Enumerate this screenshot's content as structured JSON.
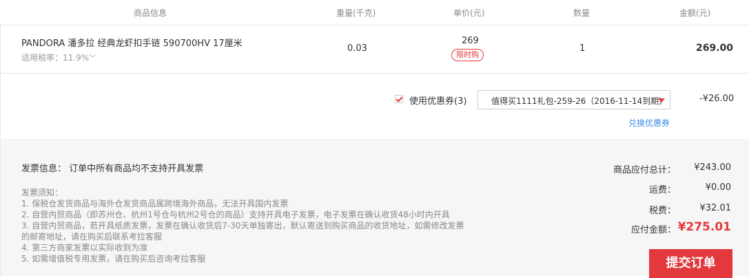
{
  "table_header": {
    "product_info": "商品信息",
    "weight": "重量(千克)",
    "unit_price": "单价(元)",
    "quantity": "数量",
    "amount": "金额(元)"
  },
  "item": {
    "name": "PANDORA 潘多拉 经典龙虾扣手链 590700HV  17厘米",
    "tax_rate": "适用税率：11.9%",
    "weight": "0.03",
    "price": "269",
    "tag": "限时购",
    "quantity": "1",
    "amount": "269.00"
  },
  "coupon": {
    "use_label": "使用优惠券(3)",
    "selected": "值得买1111礼包-259-26（2016-11-14到期)",
    "discount": "-¥26.00",
    "exchange_link": "兑换优惠券"
  },
  "invoice": {
    "title": "发票信息：  订单中所有商品均不支持开具发票",
    "notes_title": "发票须知：",
    "notes": [
      "1. 保税仓发货商品与海外仓发货商品属跨境海外商品，无法开具国内发票",
      "2. 自营内贸商品（即苏州仓、杭州1号仓与杭州2号仓的商品）支持开具电子发票，电子发票在确认收货48小时内开具",
      "3. 自营内贸商品，若开具纸质发票，发票在确认收货后7-30天单独寄出，默认寄送到购买商品的收货地址，如需修改发票",
      "的邮寄地址，请在购买后联系考拉客服",
      "4. 第三方商家发票以实际收到为准",
      "5. 如需增值税专用发票，请在购买后咨询考拉客服"
    ]
  },
  "summary": {
    "goods_total_label": "商品应付总计：",
    "goods_total": "¥243.00",
    "shipping_label": "运费：",
    "shipping": "¥0.00",
    "tax_label": "税费：",
    "tax": "¥32.01",
    "payable_label": "应付金额：",
    "payable": "¥275.01"
  },
  "submit_button": "提交订单",
  "colors": {
    "accent": "#e4393c",
    "link": "#3a8ee6"
  }
}
